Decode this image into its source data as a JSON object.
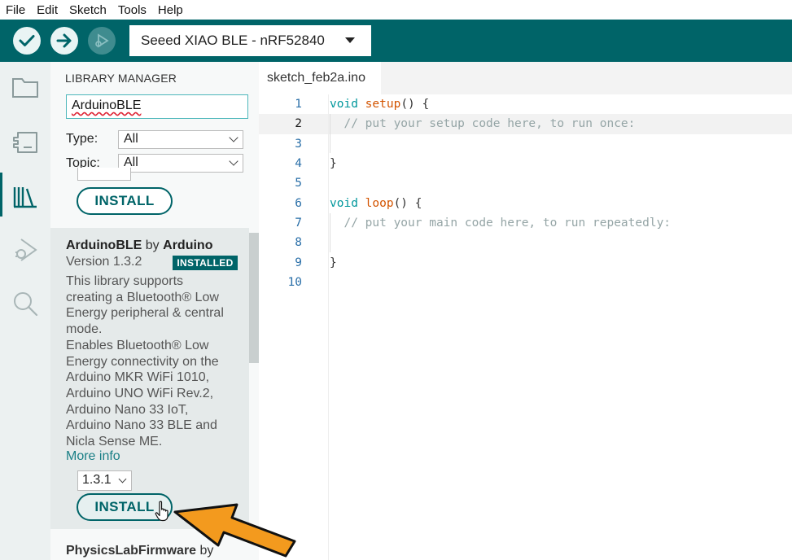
{
  "menu": [
    "File",
    "Edit",
    "Sketch",
    "Tools",
    "Help"
  ],
  "toolbar": {
    "verify_icon": "check-icon",
    "upload_icon": "arrow-right-icon",
    "debug_icon": "debugger-icon",
    "board": "Seeed XIAO BLE - nRF52840"
  },
  "sidebar": {
    "items": [
      "folder-icon",
      "board-icon",
      "library-icon",
      "debug-icon",
      "search-icon"
    ],
    "active": "library-icon"
  },
  "library_manager": {
    "title": "LIBRARY MANAGER",
    "search_value": "ArduinoBLE",
    "type_label": "Type:",
    "type_value": "All",
    "topic_label": "Topic:",
    "topic_value": "All",
    "prev_install_label": "INSTALL",
    "card": {
      "name": "ArduinoBLE",
      "by": "by",
      "author": "Arduino",
      "version": "Version 1.3.2",
      "badge": "INSTALLED",
      "description_lines": [
        "This library supports",
        "creating a Bluetooth® Low",
        "Energy peripheral & central",
        "mode.",
        "Enables Bluetooth® Low",
        "Energy connectivity on the",
        "Arduino MKR WiFi 1010,",
        "Arduino UNO WiFi Rev.2,",
        "Arduino Nano 33 IoT,",
        "Arduino Nano 33 BLE and",
        "Nicla Sense ME."
      ],
      "more_info": "More info",
      "version_select": "1.3.1",
      "install_label": "INSTALL"
    },
    "next_library": {
      "name": "PhysicsLabFirmware",
      "by": "by"
    }
  },
  "editor": {
    "tab": "sketch_feb2a.ino",
    "active_line": 2,
    "lines": [
      {
        "n": "1",
        "kw": "void",
        "fn": "setup",
        "rest": "() {"
      },
      {
        "n": "2",
        "comment": "  // put your setup code here, to run once:"
      },
      {
        "n": "3"
      },
      {
        "n": "4",
        "rest": "}"
      },
      {
        "n": "5"
      },
      {
        "n": "6",
        "kw": "void",
        "fn": "loop",
        "rest": "() {"
      },
      {
        "n": "7",
        "comment": "  // put your main code here, to run repeatedly:"
      },
      {
        "n": "8"
      },
      {
        "n": "9",
        "rest": "}"
      },
      {
        "n": "10"
      }
    ]
  },
  "colors": {
    "teal": "#006468",
    "annotation_arrow": "#f39a1e"
  }
}
